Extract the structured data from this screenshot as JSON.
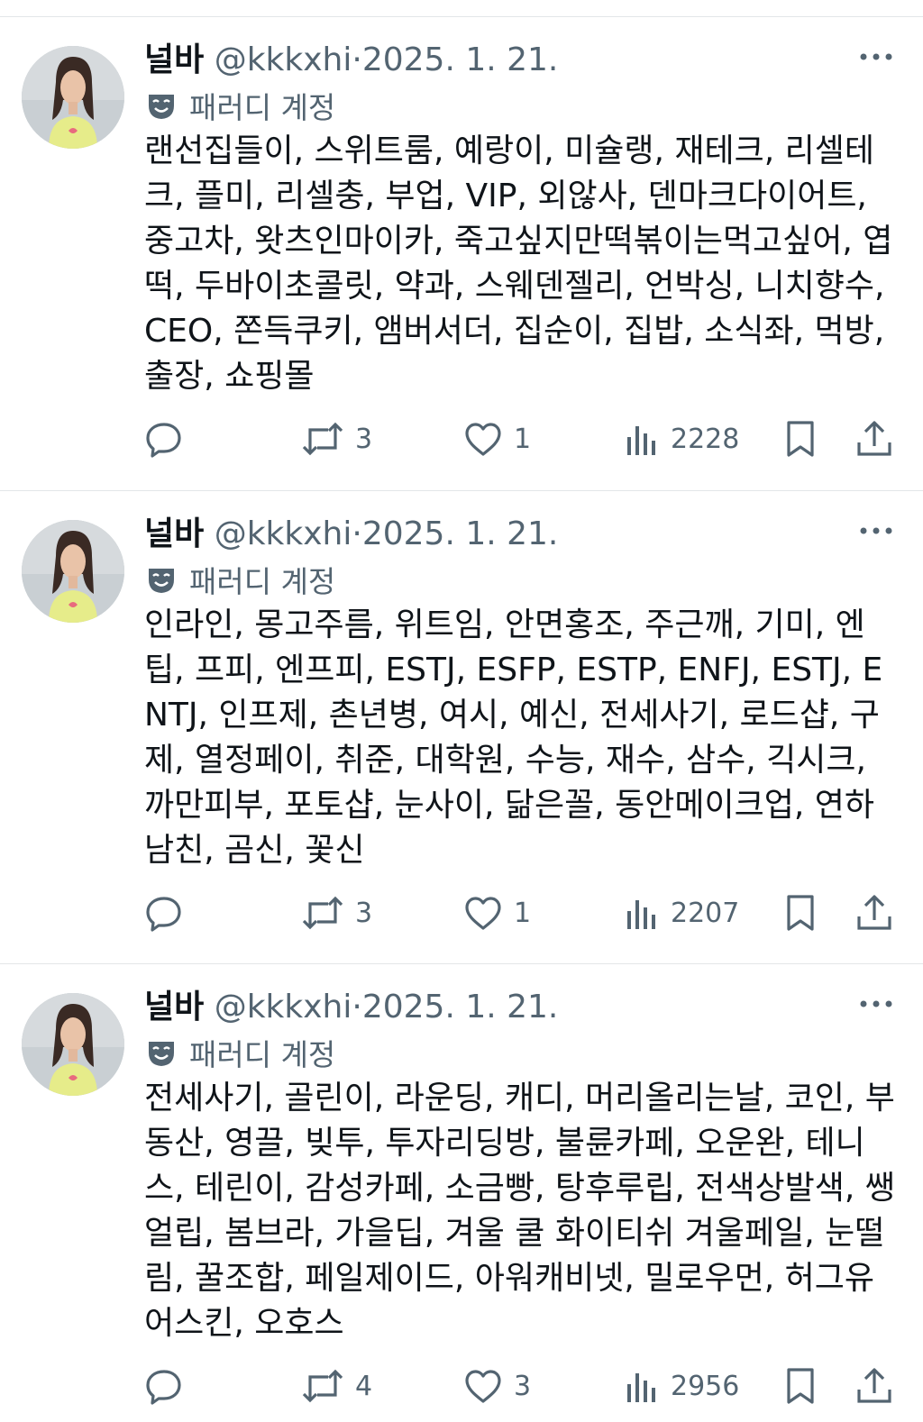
{
  "tweets": [
    {
      "name": "널바",
      "handle": "@kkkxhi",
      "separator": "·",
      "date": "2025. 1. 21.",
      "parody_label": "패러디 계정",
      "text": "랜선집들이, 스위트룸, 예랑이, 미슐랭, 재테크, 리셀테크, 플미, 리셀충, 부업, VIP, 외않사, 덴마크다이어트, 중고차, 왓츠인마이카, 죽고싶지만떡볶이는먹고싶어, 엽떡, 두바이초콜릿, 약과, 스웨덴젤리, 언박싱, 니치향수, CEO, 쫀득쿠키, 앰버서더, 집순이, 집밥, 소식좌, 먹방, 출장, 쇼핑몰",
      "retweets": "3",
      "likes": "1",
      "views": "2228"
    },
    {
      "name": "널바",
      "handle": "@kkkxhi",
      "separator": "·",
      "date": "2025. 1. 21.",
      "parody_label": "패러디 계정",
      "text": "인라인, 몽고주름, 위트임, 안면홍조, 주근깨, 기미, 엔팁, 프피, 엔프피, ESTJ, ESFP, ESTP, ENFJ, ESTJ, ENTJ, 인프제, 촌년병, 여시, 예신, 전세사기, 로드샵, 구제, 열정페이, 취준, 대학원, 수능, 재수, 삼수, 긱시크, 까만피부, 포토샵, 눈사이, 닮은꼴, 동안메이크업, 연하남친, 곰신, 꽃신",
      "retweets": "3",
      "likes": "1",
      "views": "2207"
    },
    {
      "name": "널바",
      "handle": "@kkkxhi",
      "separator": "·",
      "date": "2025. 1. 21.",
      "parody_label": "패러디 계정",
      "text": "전세사기, 골린이, 라운딩, 캐디, 머리올리는날, 코인, 부동산, 영끌, 빚투, 투자리딩방, 불륜카페, 오운완, 테니스, 테린이, 감성카페, 소금빵, 탕후루립, 전색상발색, 쌩얼립, 봄브라, 가을딥, 겨울 쿨 화이티쉬 겨울페일, 눈떨림, 꿀조합, 페일제이드, 아워캐비넷, 밀로우먼, 허그유어스킨, 오호스",
      "retweets": "4",
      "likes": "3",
      "views": "2956"
    }
  ],
  "colors": {
    "text_primary": "#0f1419",
    "text_secondary": "#536471",
    "divider": "#e3e6e8"
  },
  "icons": [
    "more-icon",
    "parody-mask-icon",
    "reply-icon",
    "retweet-icon",
    "like-icon",
    "views-icon",
    "bookmark-icon",
    "share-icon"
  ]
}
